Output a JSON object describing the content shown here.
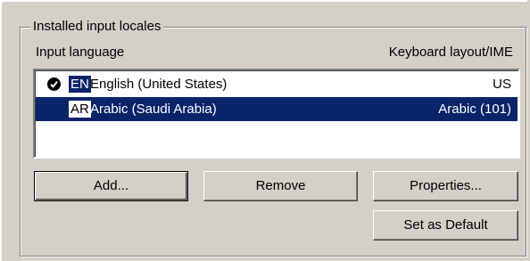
{
  "group": {
    "title": "Installed input locales"
  },
  "columns": {
    "input_language": "Input language",
    "keyboard_layout": "Keyboard layout/IME"
  },
  "locales": [
    {
      "code": "EN",
      "name": "English (United States)",
      "layout": "US",
      "is_default": true,
      "selected": false
    },
    {
      "code": "AR",
      "name": "Arabic (Saudi Arabia)",
      "layout": "Arabic (101)",
      "is_default": false,
      "selected": true
    }
  ],
  "buttons": {
    "add": "Add...",
    "remove": "Remove",
    "properties": "Properties...",
    "set_default": "Set as Default"
  },
  "colors": {
    "face": "#d4d0c8",
    "selection": "#0a246a",
    "window": "#ffffff"
  },
  "icons": {
    "default_marker": "check-circle-icon"
  }
}
